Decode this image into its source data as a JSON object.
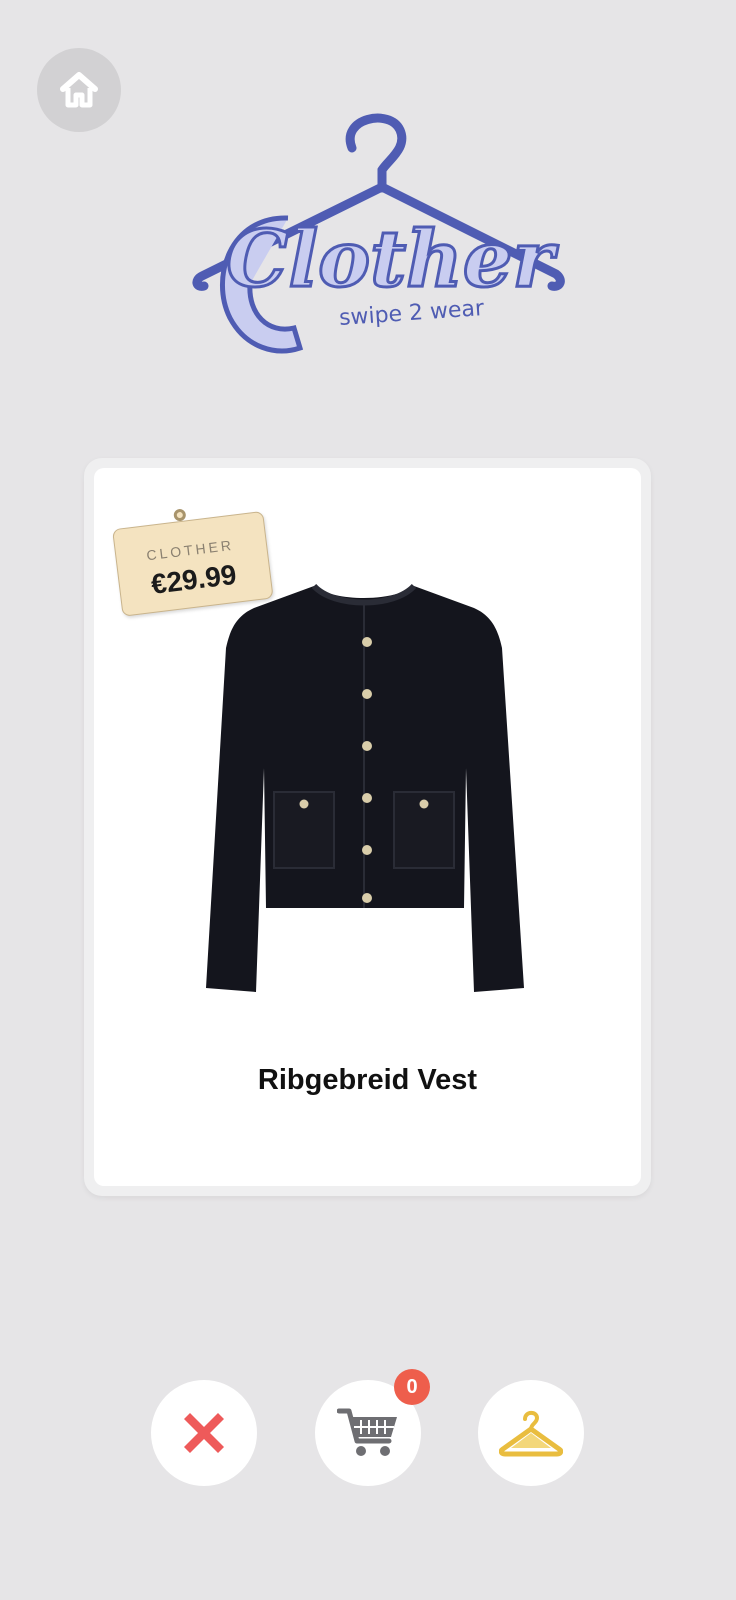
{
  "header": {
    "home_icon": "home-icon"
  },
  "logo": {
    "title": "Clother",
    "tagline": "swipe 2 wear",
    "icon": "hanger-icon",
    "colors": {
      "primary": "#4f5cb3",
      "fill": "#c9cdf0"
    }
  },
  "card": {
    "price_tag": {
      "brand": "CLOTHER",
      "price": "€29.99"
    },
    "product_name": "Ribgebreid Vest",
    "image_icon": "cardigan-image"
  },
  "actions": {
    "reject_icon": "close-icon",
    "cart_icon": "cart-icon",
    "cart_count": "0",
    "wear_icon": "hanger-icon"
  },
  "colors": {
    "background": "#e6e5e7",
    "reject": "#ee5a5a",
    "badge": "#ee5e4c",
    "wear": "#e9bd3f",
    "cart": "#6e6e72"
  }
}
